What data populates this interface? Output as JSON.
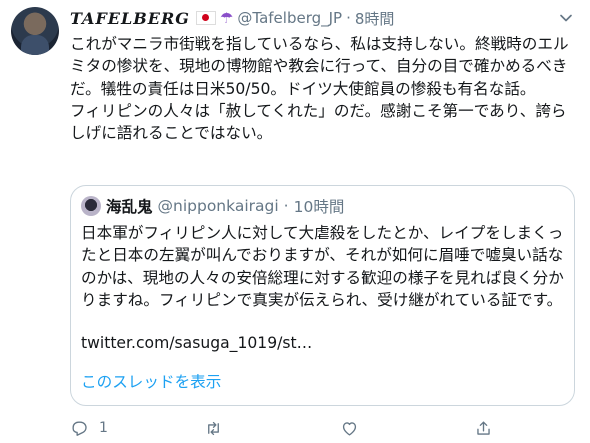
{
  "tweet": {
    "display_name": "TAFELBERG",
    "handle": "@Tafelberg_JP",
    "separator": "·",
    "time": "8時間",
    "text": "これがマニラ市街戦を指しているなら、私は支持しない。終戦時のエルミタの惨状を、現地の博物館や教会に行って、自分の目で確かめるべきだ。犠牲の責任は日米50/50。ドイツ大使館員の惨殺も有名な話。\nフィリピンの人々は「赦してくれた」のだ。感謝こそ第一であり、誇らしげに語れることではない。"
  },
  "quote": {
    "display_name": "海乱鬼",
    "handle": "@nipponkairagi",
    "separator": "·",
    "time": "10時間",
    "text": "日本軍がフィリピン人に対して大虐殺をしたとか、レイプをしまくったと日本の左翼が叫んでおりますが、それが如何に眉唾で嘘臭い話なのかは、現地の人々の安倍総理に対する歓迎の様子を見れば良く分かりますね。フィリピンで真実が伝えられ、受け継がれている証です。",
    "link": "twitter.com/sasuga_1019/st…",
    "show_thread": "このスレッドを表示"
  },
  "actions": {
    "reply_count": "1",
    "retweet_count": "",
    "like_count": ""
  },
  "icons": [
    "avatar",
    "japan-flag-icon",
    "umbrella-icon",
    "more-chevron-icon",
    "reply-icon",
    "retweet-icon",
    "like-icon",
    "share-icon"
  ],
  "colors": {
    "link_blue": "#1da1f2",
    "meta_gray": "#657786",
    "border": "#ccd6dd"
  }
}
